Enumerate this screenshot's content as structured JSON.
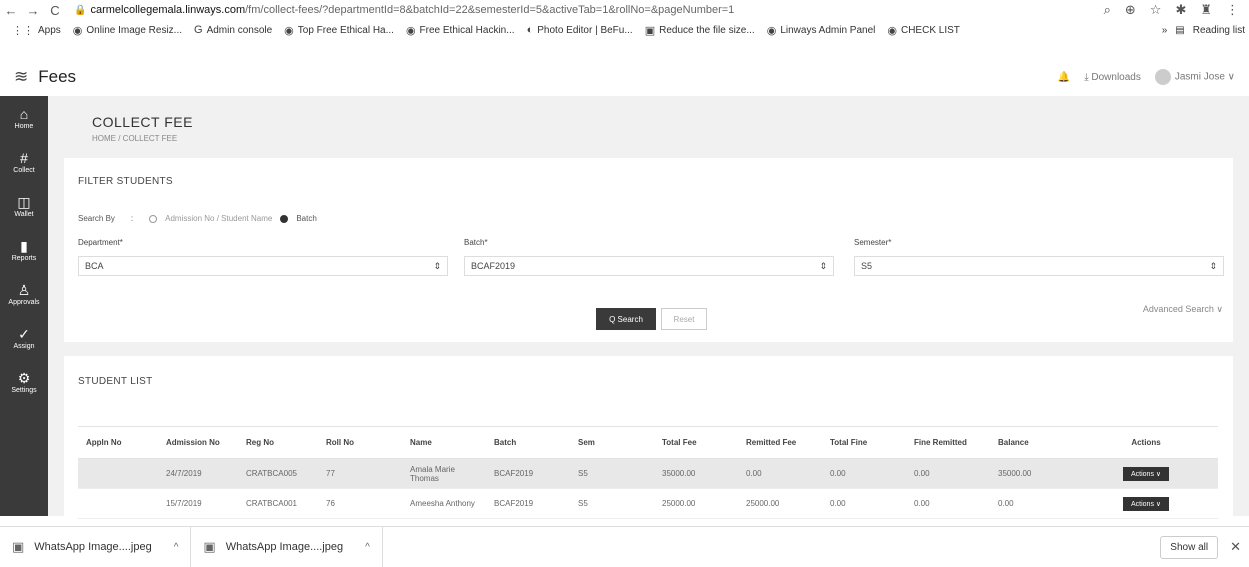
{
  "browser": {
    "url_host": "carmelcollegemala.linways.com",
    "url_path": "/fm/collect-fees/?departmentId=8&batchId=22&semesterId=5&activeTab=1&rollNo=&pageNumber=1",
    "bookmarks": [
      {
        "label": "Apps",
        "icon": "apps-grid-icon"
      },
      {
        "label": "Online Image Resiz...",
        "icon": "globe-icon"
      },
      {
        "label": "Admin console",
        "icon": "google-icon"
      },
      {
        "label": "Top Free Ethical Ha...",
        "icon": "globe-icon"
      },
      {
        "label": "Free Ethical Hackin...",
        "icon": "globe-icon"
      },
      {
        "label": "Photo Editor | BeFu...",
        "icon": "befunky-icon"
      },
      {
        "label": "Reduce the file size...",
        "icon": "pdf-icon"
      },
      {
        "label": "Linways Admin Panel",
        "icon": "globe-icon"
      },
      {
        "label": "CHECK LIST",
        "icon": "globe-icon"
      }
    ],
    "more": "»",
    "reading_list": "Reading list"
  },
  "app": {
    "title": "Fees",
    "downloads_label": "Downloads",
    "user_name": "Jasmi Jose"
  },
  "sidebar": {
    "items": [
      {
        "label": "Home",
        "icon": "home-icon",
        "glyph": "⌂"
      },
      {
        "label": "Collect",
        "icon": "hash-icon",
        "glyph": "#"
      },
      {
        "label": "Wallet",
        "icon": "wallet-icon",
        "glyph": "◫"
      },
      {
        "label": "Reports",
        "icon": "bar-chart-icon",
        "glyph": "▮"
      },
      {
        "label": "Approvals",
        "icon": "user-check-icon",
        "glyph": "♙"
      },
      {
        "label": "Assign",
        "icon": "check-circle-icon",
        "glyph": "✓"
      },
      {
        "label": "Settings",
        "icon": "gear-icon",
        "glyph": "⚙"
      }
    ]
  },
  "page": {
    "title": "COLLECT FEE",
    "breadcrumb": "HOME / COLLECT FEE"
  },
  "filter": {
    "title": "FILTER STUDENTS",
    "search_by_label": "Search By",
    "colon": ":",
    "option_admission": "Admission No / Student Name",
    "option_batch": "Batch",
    "department_label": "Department*",
    "department_value": "BCA",
    "batch_label": "Batch*",
    "batch_value": "BCAF2019",
    "semester_label": "Semester*",
    "semester_value": "S5",
    "search_button": "Q Search",
    "reset_button": "Reset",
    "advanced_search": "Advanced Search ∨"
  },
  "student_list": {
    "title": "STUDENT LIST",
    "headers": [
      "Appln No",
      "Admission No",
      "Reg No",
      "Roll No",
      "Name",
      "Batch",
      "Sem",
      "Total Fee",
      "Remitted Fee",
      "Total Fine",
      "Fine Remitted",
      "Balance",
      "Actions"
    ],
    "rows": [
      [
        "",
        "24/7/2019",
        "CRATBCA005",
        "77",
        "Amala Marie Thomas",
        "BCAF2019",
        "S5",
        "35000.00",
        "0.00",
        "0.00",
        "0.00",
        "35000.00",
        "Actions ∨"
      ],
      [
        "",
        "15/7/2019",
        "CRATBCA001",
        "76",
        "Ameesha Anthony",
        "BCAF2019",
        "S5",
        "25000.00",
        "25000.00",
        "0.00",
        "0.00",
        "0.00",
        "Actions ∨"
      ]
    ]
  },
  "downloads": {
    "items": [
      "WhatsApp Image....jpeg",
      "WhatsApp Image....jpeg"
    ],
    "show_all": "Show all"
  }
}
